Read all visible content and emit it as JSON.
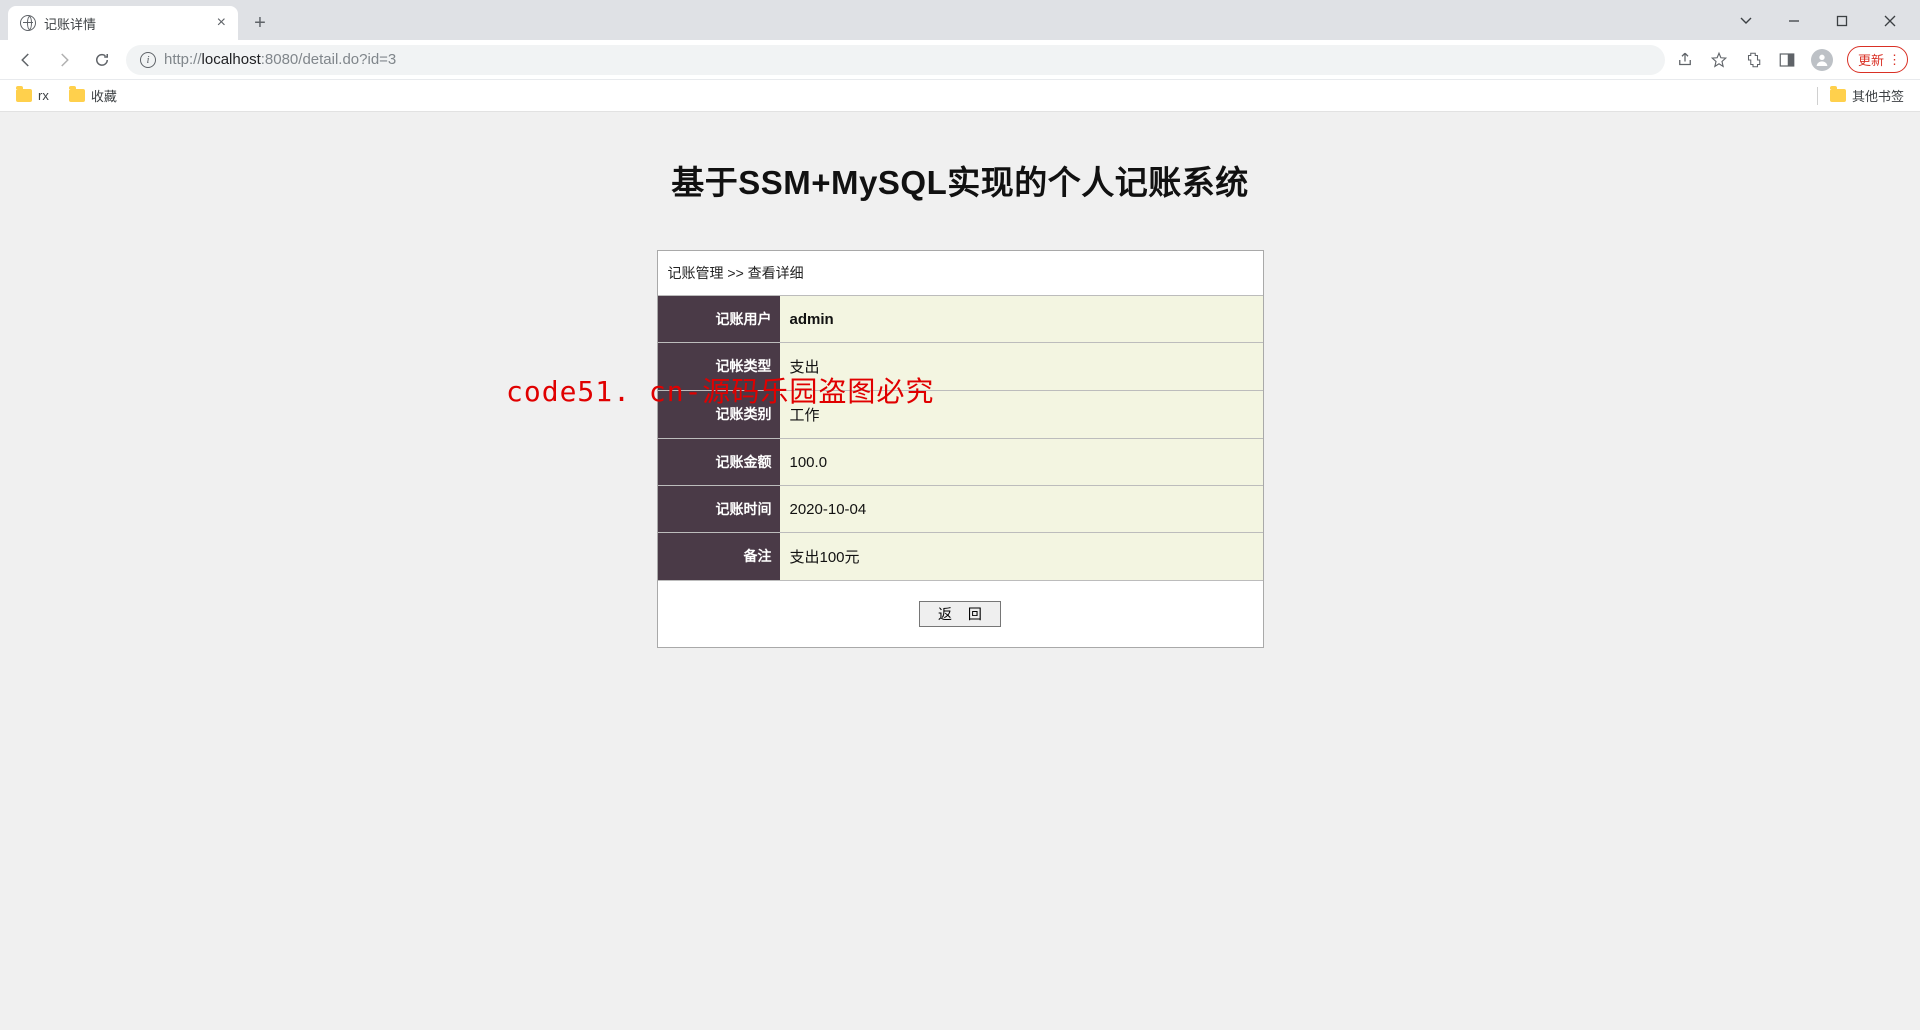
{
  "browser": {
    "tab_title": "记账详情",
    "url_full": "http://localhost:8080/detail.do?id=3",
    "url_host_prefix": "http://",
    "url_host": "localhost",
    "url_port_path": ":8080/detail.do?id=3",
    "update_label": "更新",
    "bookmarks": {
      "rx": "rx",
      "fav": "收藏",
      "other": "其他书签"
    }
  },
  "page": {
    "title": "基于SSM+MySQL实现的个人记账系统",
    "breadcrumb": "记账管理 >> 查看详细",
    "fields": {
      "user_label": "记账用户",
      "user_value": "admin",
      "type_label": "记帐类型",
      "type_value": "支出",
      "category_label": "记账类别",
      "category_value": "工作",
      "amount_label": "记账金额",
      "amount_value": "100.0",
      "time_label": "记账时间",
      "time_value": "2020-10-04",
      "remark_label": "备注",
      "remark_value": "支出100元"
    },
    "back_button": "返 回"
  },
  "watermark": "code51. cn-源码乐园盗图必究"
}
